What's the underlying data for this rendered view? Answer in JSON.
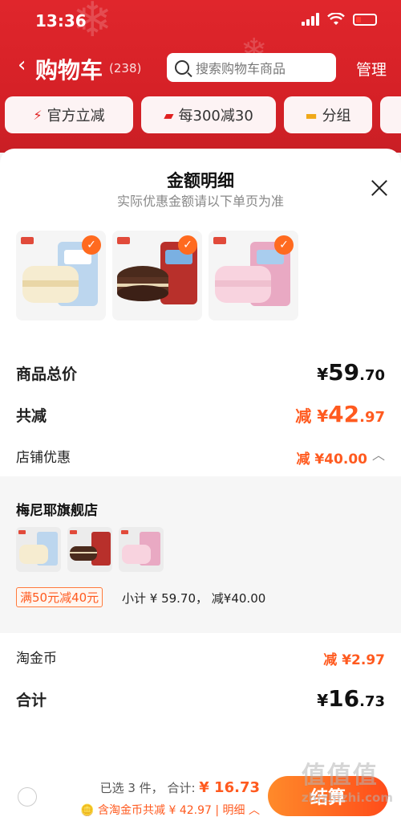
{
  "status": {
    "time": "13:36"
  },
  "nav": {
    "title": "购物车",
    "count": "(238)",
    "search_placeholder": "搜索购物车商品",
    "manage": "管理"
  },
  "filters": [
    {
      "label": "官方立减",
      "icon": "lightning-icon"
    },
    {
      "label": "每300减30",
      "icon": "coupon-icon"
    },
    {
      "label": "分组",
      "icon": "folder-icon"
    }
  ],
  "sheet": {
    "title": "金额明细",
    "subtitle": "实际优惠金额请以下单页为准",
    "products": [
      {
        "name": "white-wafer-cake",
        "color": "#f2e7c8",
        "accent": "#9ec3e6"
      },
      {
        "name": "chocolate-pie",
        "color": "#5b3424",
        "accent": "#c7302b"
      },
      {
        "name": "pink-wafer-cake",
        "color": "#f5cddb",
        "accent": "#8ec0e8"
      }
    ],
    "total_label": "商品总价",
    "total_currency": "¥",
    "total_int": "59",
    "total_dec": ".70",
    "discount_label": "共减",
    "discount_prefix": "减 ¥",
    "discount_int": "42",
    "discount_dec": ".97",
    "store_discount_label": "店铺优惠",
    "store_discount_value": "减 ¥40.00",
    "store": {
      "name": "梅尼耶旗舰店",
      "promo": "满50元减40元",
      "subtotal": "小计 ¥ 59.70， 减¥40.00"
    },
    "coin_label": "淘金币",
    "coin_value": "减 ¥2.97",
    "sum_label": "合计",
    "sum_currency": "¥",
    "sum_int": "16",
    "sum_dec": ".73"
  },
  "bottom": {
    "selected": "已选 3 件， 合计: ",
    "selected_total": "¥ 16.73",
    "coin_note": "含淘金币共减 ¥ 42.97 | 明细",
    "checkout": "结算"
  },
  "watermark": {
    "logo": "值值值",
    "url": "zhizhizhi.com"
  },
  "colors": {
    "brand_red": "#d42026",
    "accent_orange": "#ff5a1f"
  }
}
